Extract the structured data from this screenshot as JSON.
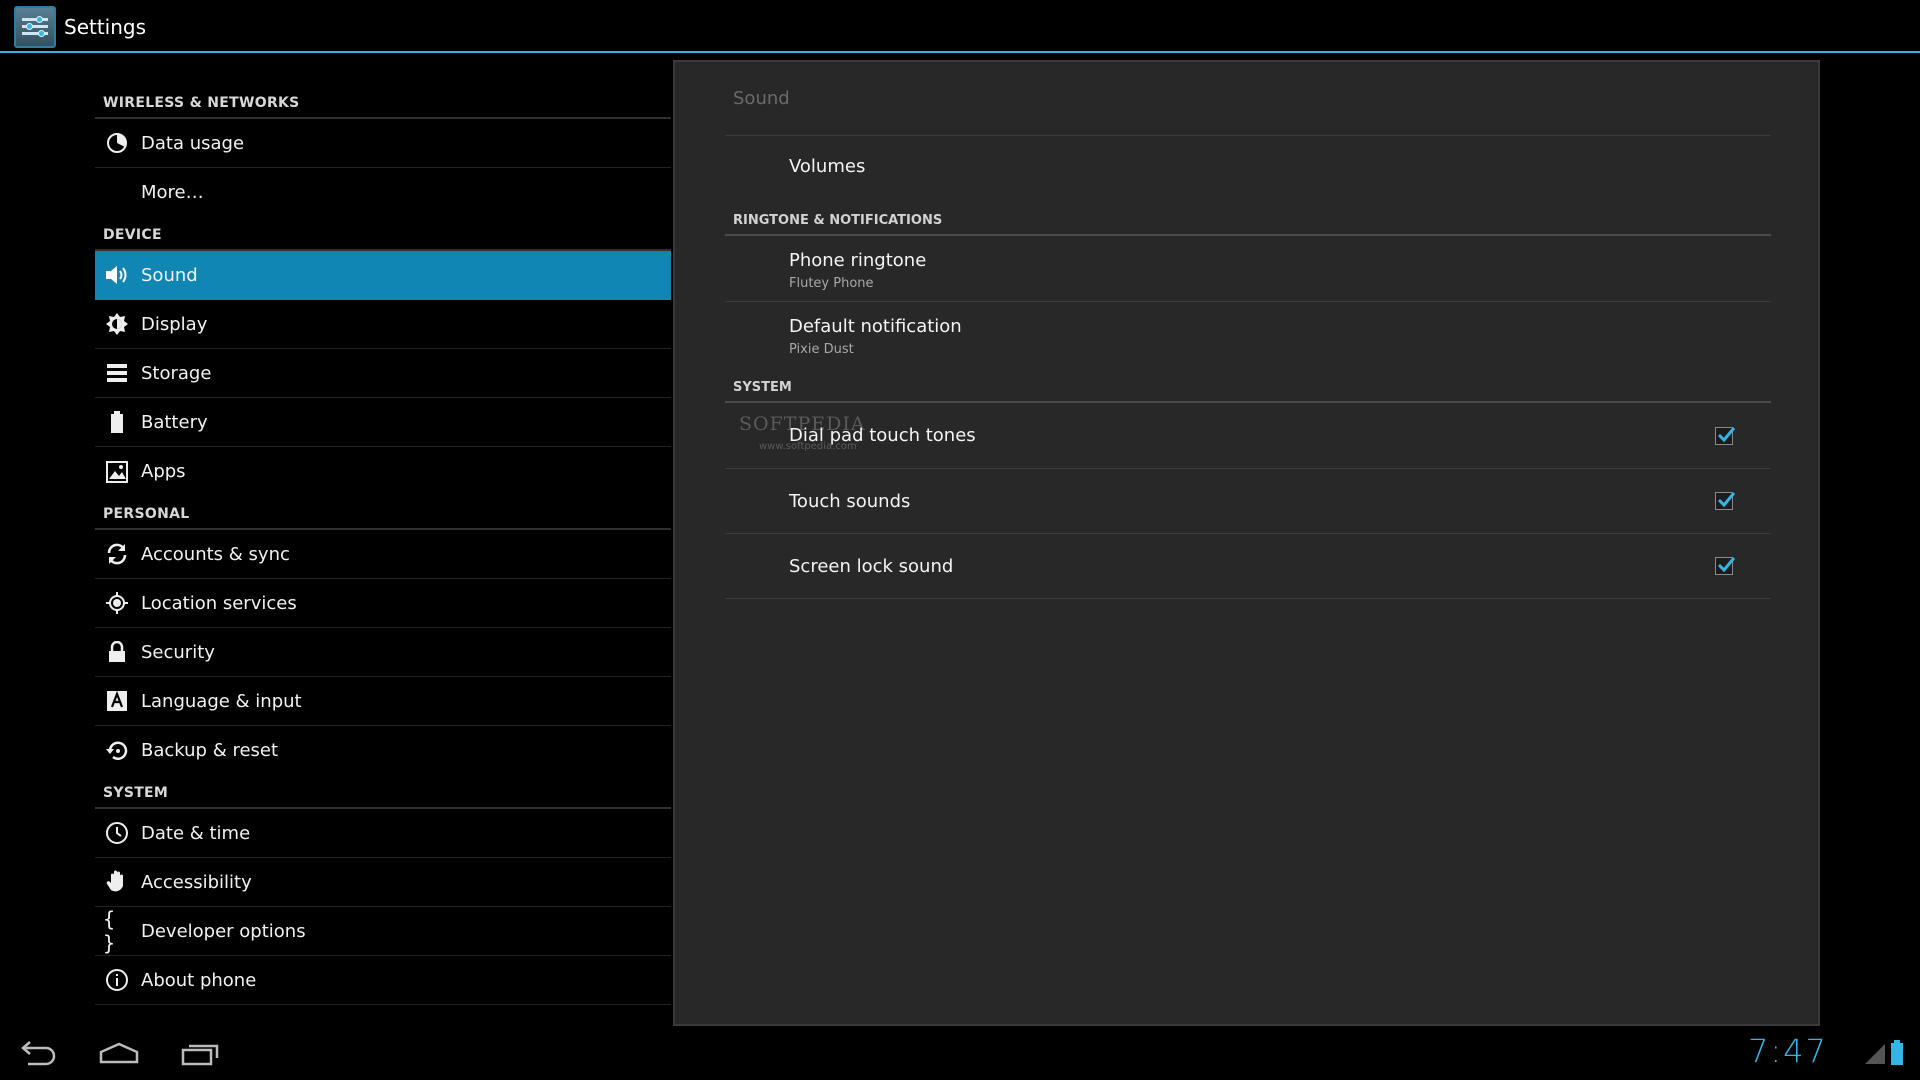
{
  "app": {
    "title": "Settings"
  },
  "sidebar": {
    "sections": [
      {
        "header": "WIRELESS & NETWORKS",
        "items": [
          {
            "label": "Data usage",
            "icon": "data-usage-icon"
          },
          {
            "label": "More…",
            "icon": ""
          }
        ]
      },
      {
        "header": "DEVICE",
        "items": [
          {
            "label": "Sound",
            "icon": "speaker-icon",
            "selected": true
          },
          {
            "label": "Display",
            "icon": "brightness-icon"
          },
          {
            "label": "Storage",
            "icon": "storage-icon"
          },
          {
            "label": "Battery",
            "icon": "battery-icon"
          },
          {
            "label": "Apps",
            "icon": "apps-icon"
          }
        ]
      },
      {
        "header": "PERSONAL",
        "items": [
          {
            "label": "Accounts & sync",
            "icon": "sync-icon"
          },
          {
            "label": "Location services",
            "icon": "location-icon"
          },
          {
            "label": "Security",
            "icon": "lock-icon"
          },
          {
            "label": "Language & input",
            "icon": "keyboard-letter-icon"
          },
          {
            "label": "Backup & reset",
            "icon": "backup-icon"
          }
        ]
      },
      {
        "header": "SYSTEM",
        "items": [
          {
            "label": "Date & time",
            "icon": "clock-icon"
          },
          {
            "label": "Accessibility",
            "icon": "hand-icon"
          },
          {
            "label": "Developer options",
            "icon": "braces-icon"
          },
          {
            "label": "About phone",
            "icon": "info-icon"
          }
        ]
      }
    ]
  },
  "detail": {
    "title": "Sound",
    "volumes": "Volumes",
    "ringtone_header": "RINGTONE & NOTIFICATIONS",
    "phone_ringtone": {
      "title": "Phone ringtone",
      "summary": "Flutey Phone"
    },
    "default_notification": {
      "title": "Default notification",
      "summary": "Pixie Dust"
    },
    "system_header": "SYSTEM",
    "dial_pad": {
      "title": "Dial pad touch tones",
      "checked": true
    },
    "touch_sounds": {
      "title": "Touch sounds",
      "checked": true
    },
    "screen_lock": {
      "title": "Screen lock sound",
      "checked": true
    },
    "watermark": "SOFTPEDIA",
    "watermark_url": "www.softpedia.com"
  },
  "statusbar": {
    "time": "7:47"
  },
  "colors": {
    "accent": "#33b5e5",
    "selected": "#0f86b3",
    "panel": "#282828"
  }
}
